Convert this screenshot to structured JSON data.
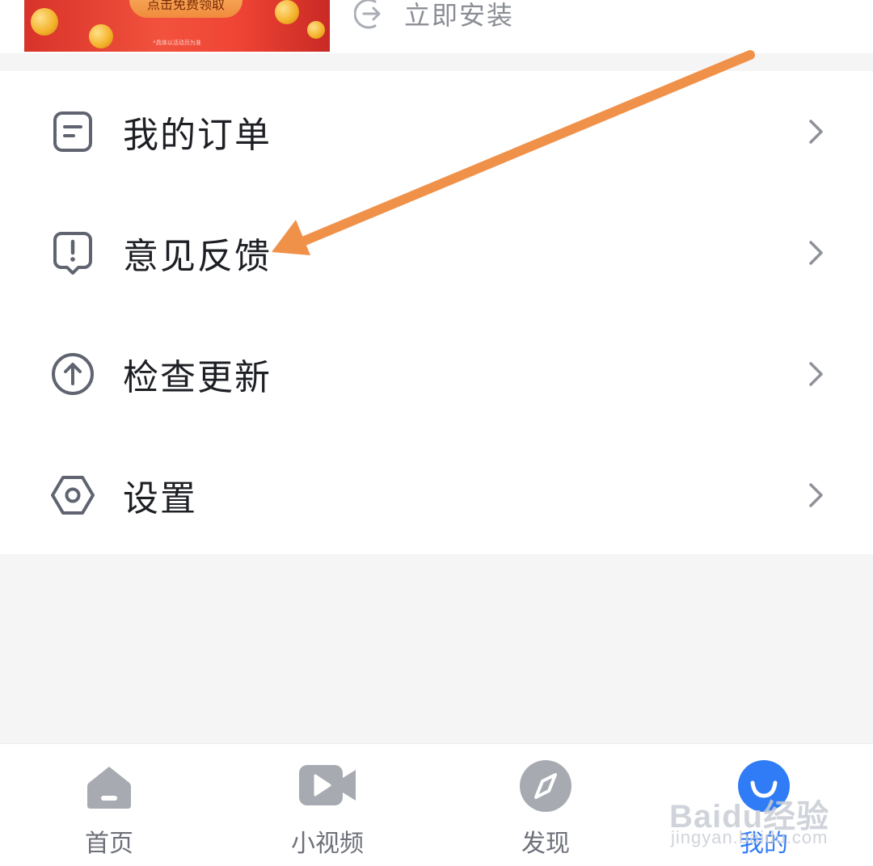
{
  "banner": {
    "button_label": "点击免费领取",
    "fine_print": "*具体以活动页为准"
  },
  "install": {
    "label": "立即安装",
    "icon": "install-arrow-icon"
  },
  "menu": {
    "items": [
      {
        "label": "我的订单",
        "icon": "order-document-icon"
      },
      {
        "label": "意见反馈",
        "icon": "feedback-exclamation-icon"
      },
      {
        "label": "检查更新",
        "icon": "update-arrow-up-icon"
      },
      {
        "label": "设置",
        "icon": "settings-hexagon-icon"
      }
    ]
  },
  "bottom_nav": {
    "items": [
      {
        "label": "首页",
        "icon": "home-icon",
        "active": false
      },
      {
        "label": "小视频",
        "icon": "video-camera-icon",
        "active": false
      },
      {
        "label": "发现",
        "icon": "compass-icon",
        "active": false
      },
      {
        "label": "我的",
        "icon": "profile-icon",
        "active": true
      }
    ]
  },
  "watermark": {
    "logo": "Baidu经验",
    "sub": "jingyan.baidu.com"
  },
  "colors": {
    "accent": "#2f7cf6",
    "text_primary": "#1d1f24",
    "icon_gray": "#5f6470",
    "annotation_arrow": "#f0914a",
    "banner_red": "#e8402f"
  }
}
